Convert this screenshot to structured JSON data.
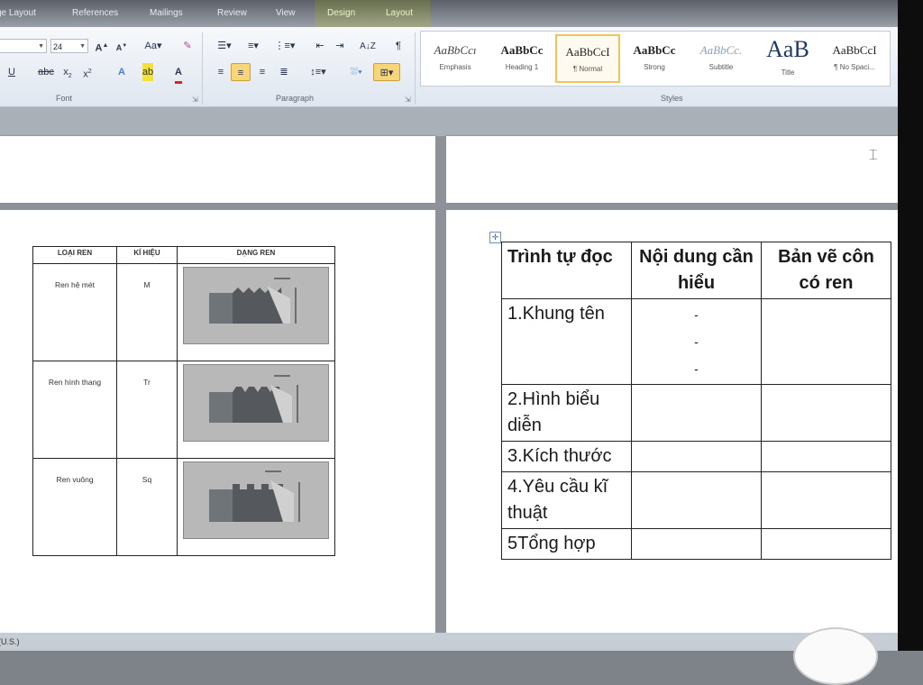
{
  "ribbon": {
    "tabs": [
      "ge Layout",
      "References",
      "Mailings",
      "Review",
      "View",
      "Design",
      "Layout"
    ],
    "font": {
      "name_value": "",
      "size_value": "24",
      "group_label": "Font"
    },
    "paragraph": {
      "group_label": "Paragraph"
    },
    "styles": {
      "group_label": "Styles",
      "items": [
        {
          "sample": "AaBbCcı",
          "name": "Emphasis"
        },
        {
          "sample": "AaBbCc",
          "name": "Heading 1"
        },
        {
          "sample": "AaBbCcI",
          "name": "¶ Normal"
        },
        {
          "sample": "AaBbCc",
          "name": "Strong"
        },
        {
          "sample": "AaBbCc.",
          "name": "Subtitle"
        },
        {
          "sample": "AaB",
          "name": "Title"
        },
        {
          "sample": "AaBbCcI",
          "name": "¶ No Spaci..."
        }
      ]
    }
  },
  "left_table": {
    "headers": [
      "LOẠI REN",
      "KÍ HIỆU",
      "DẠNG REN"
    ],
    "rows": [
      {
        "type": "Ren hệ mét",
        "symbol": "M"
      },
      {
        "type": "Ren hình thang",
        "symbol": "Tr"
      },
      {
        "type": "Ren vuông",
        "symbol": "Sq"
      }
    ]
  },
  "right_table": {
    "headers": [
      "Trình tự đọc",
      "Nội dung cần hiểu",
      "Bản vẽ côn có ren"
    ],
    "rows": [
      "1.Khung tên",
      "2.Hình biểu diễn",
      "3.Kích thước",
      "4.Yêu cầu kĩ thuật",
      "5Tổng hợp"
    ],
    "dashes": [
      "-",
      "-",
      "-"
    ]
  },
  "status_bar": {
    "language": "(U.S.)"
  },
  "colors": {
    "selected_style_border": "#f0c45a",
    "active_button": "#f7d57a"
  }
}
